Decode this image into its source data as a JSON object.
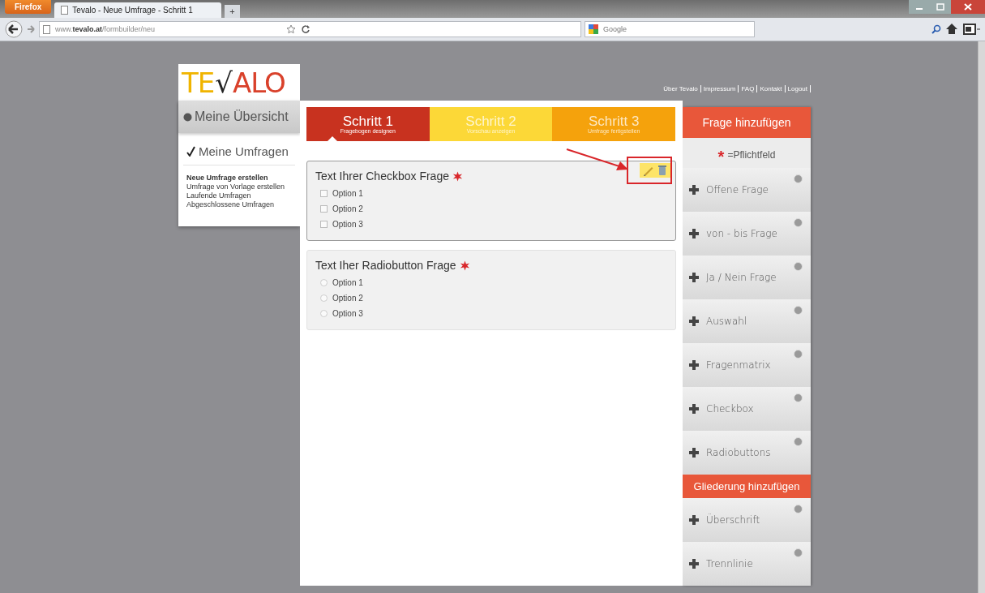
{
  "browser": {
    "menu_button": "Firefox",
    "tab_title": "Tevalo - Neue Umfrage - Schritt 1",
    "new_tab": "+",
    "url": "www.**tevalo.at**/formbuilder/neu",
    "search_placeholder": "Google"
  },
  "logo": [
    {
      "text": "TE",
      "color": "#f0b400"
    },
    {
      "text": "√",
      "color": "#222222"
    },
    {
      "text": "ALO",
      "color": "#d9412b"
    }
  ],
  "top_links": [
    "Über Tevalo",
    "Impressum",
    "FAQ",
    "Kontakt",
    "Logout"
  ],
  "sidebar": {
    "overview": "Meine Übersicht",
    "surveys": "Meine Umfragen",
    "items": [
      {
        "label": "Neue Umfrage erstellen",
        "selected": true
      },
      {
        "label": "Umfrage von Vorlage erstellen",
        "selected": false
      },
      {
        "label": "Laufende Umfragen",
        "selected": false
      },
      {
        "label": "Abgeschlossene Umfragen",
        "selected": false
      }
    ]
  },
  "steps": [
    {
      "title": "Schritt 1",
      "subtitle": "Fragebogen designen",
      "color": "#c8321f",
      "selected": true
    },
    {
      "title": "Schritt 2",
      "subtitle": "Vorschau anzeigen",
      "color": "#fcd837",
      "selected": false
    },
    {
      "title": "Schritt 3",
      "subtitle": "Umfrage fertigstellen",
      "color": "#f5a20c",
      "selected": false
    }
  ],
  "questions": [
    {
      "kind": "checkbox",
      "title": "Text Ihrer Checkbox Frage",
      "required": true,
      "editing": true,
      "options": [
        "Option 1",
        "Option 2",
        "Option 3"
      ]
    },
    {
      "kind": "radio",
      "title": "Text Iher Radiobutton Frage",
      "required": true,
      "editing": false,
      "options": [
        "Option 1",
        "Option 2",
        "Option 3"
      ]
    }
  ],
  "add_panel": {
    "legend_mark": "*",
    "legend": "=Pflichtfeld",
    "sections": [
      {
        "title": "Frage hinzufügen",
        "items": [
          "Offene Frage",
          "von - bis Frage",
          "Ja / Nein Frage",
          "Auswahl",
          "Fragenmatrix",
          "Checkbox",
          "Radiobuttons"
        ]
      },
      {
        "title": "Gliederung hinzufügen",
        "items": [
          "Überschrift",
          "Trennlinie"
        ]
      }
    ]
  }
}
